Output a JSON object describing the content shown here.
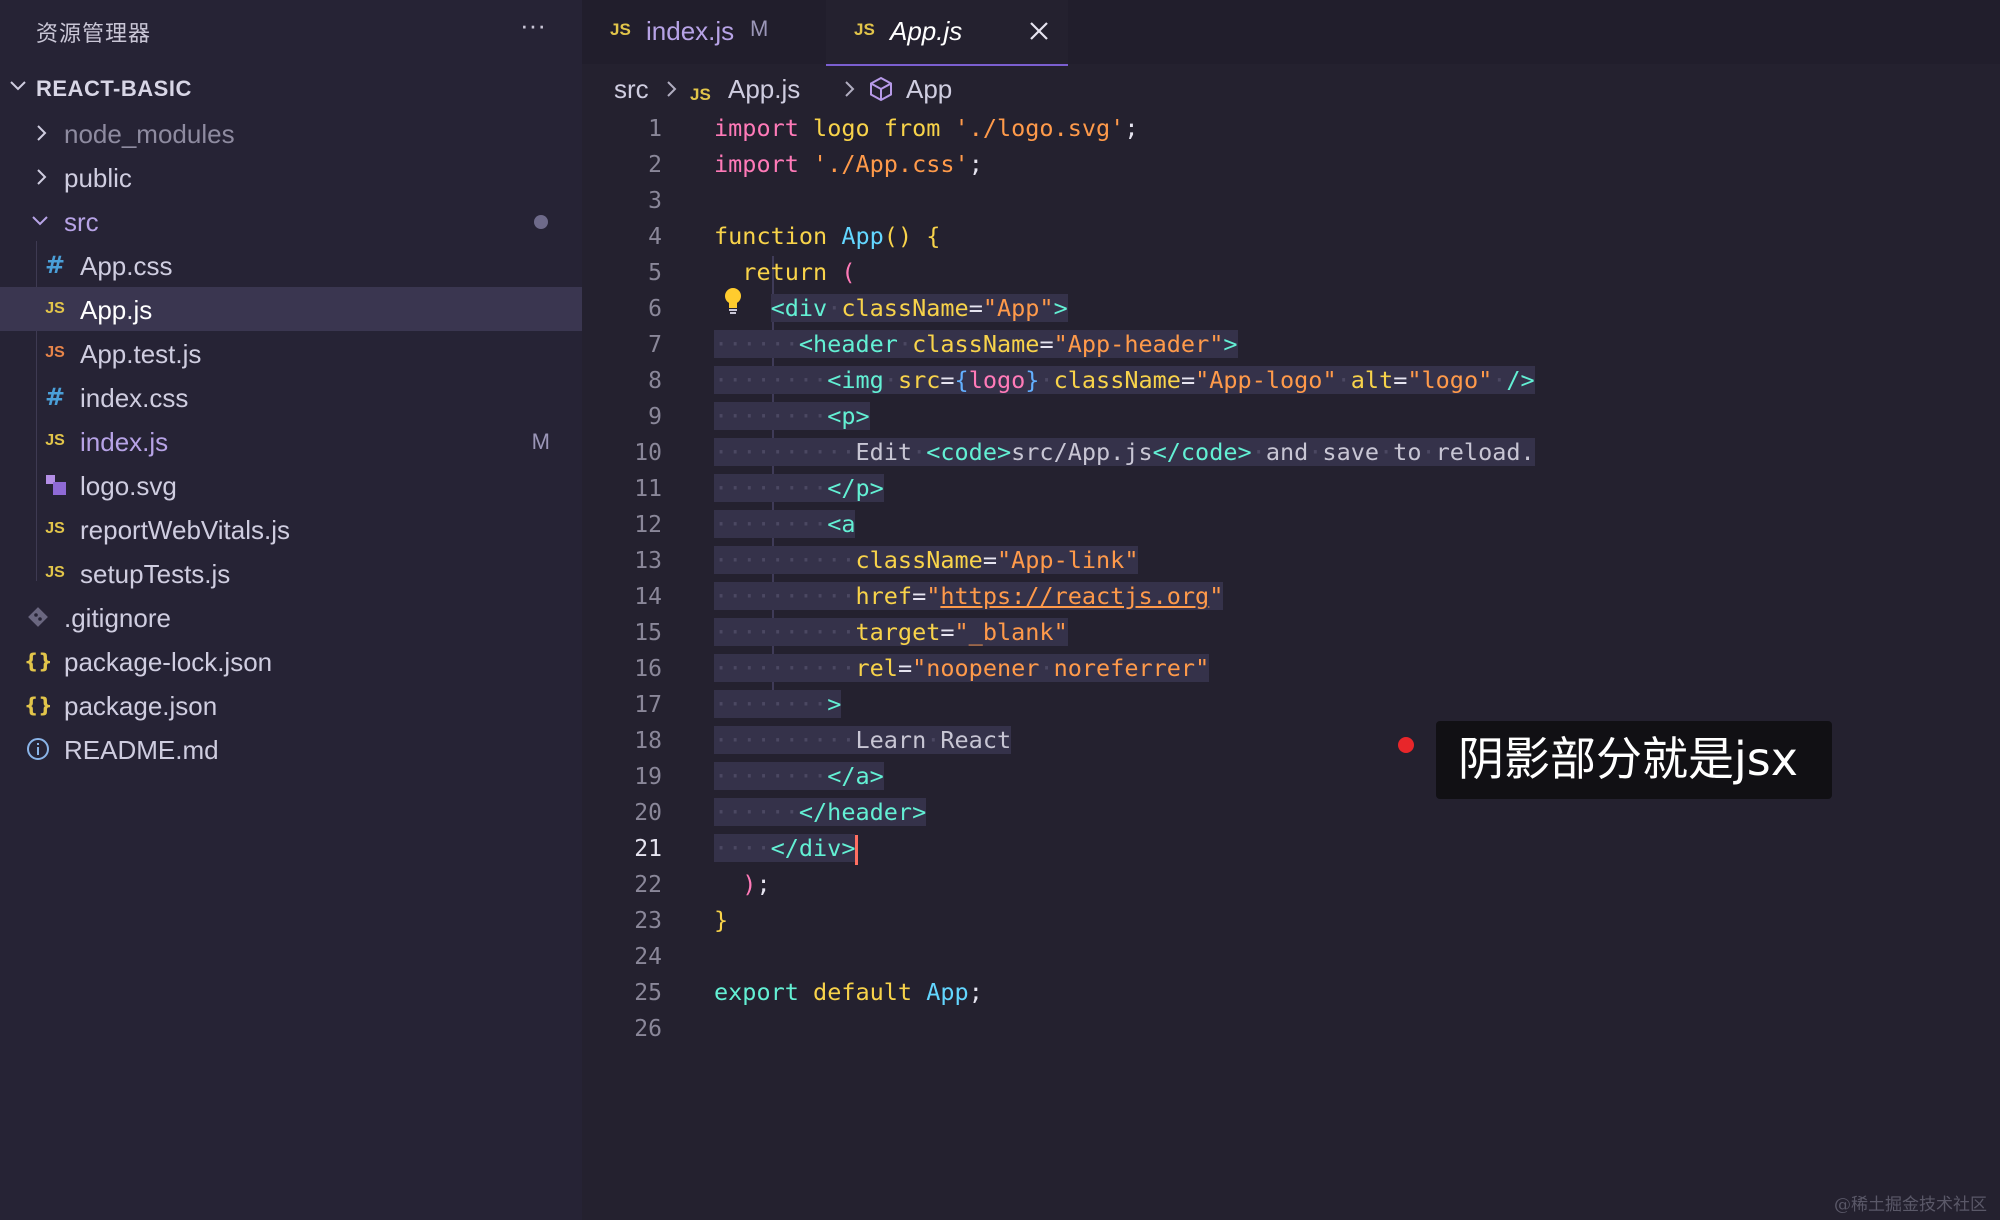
{
  "sidebar": {
    "title": "资源管理器",
    "more": "···",
    "project": "REACT-BASIC",
    "items": [
      {
        "label": "node_modules",
        "icon": "chevron-right-icon"
      },
      {
        "label": "public",
        "icon": "chevron-right-icon"
      },
      {
        "label": "src",
        "icon": "chevron-down-icon"
      },
      {
        "label": "App.css",
        "icon": "#"
      },
      {
        "label": "App.js",
        "icon": "JS"
      },
      {
        "label": "App.test.js",
        "icon": "JS"
      },
      {
        "label": "index.css",
        "icon": "#"
      },
      {
        "label": "index.js",
        "icon": "JS",
        "badge": "M"
      },
      {
        "label": "logo.svg",
        "icon": "svg-file-icon"
      },
      {
        "label": "reportWebVitals.js",
        "icon": "JS"
      },
      {
        "label": "setupTests.js",
        "icon": "JS"
      },
      {
        "label": ".gitignore",
        "icon": "git-icon"
      },
      {
        "label": "package-lock.json",
        "icon": "{}"
      },
      {
        "label": "package.json",
        "icon": "{}"
      },
      {
        "label": "README.md",
        "icon": "info-icon"
      }
    ]
  },
  "tabs": [
    {
      "icon": "JS",
      "label": "index.js",
      "badge": "M"
    },
    {
      "icon": "JS",
      "label": "App.js",
      "close": "close-icon"
    }
  ],
  "breadcrumb": [
    "src",
    "JS",
    "App.js",
    "App"
  ],
  "code": {
    "lines": [
      "import logo from './logo.svg';",
      "import './App.css';",
      "",
      "function App() {",
      "  return (",
      "    <div className=\"App\">",
      "      <header className=\"App-header\">",
      "        <img src={logo} className=\"App-logo\" alt=\"logo\" />",
      "        <p>",
      "          Edit <code>src/App.js</code> and save to reload.",
      "        </p>",
      "        <a",
      "          className=\"App-link\"",
      "          href=\"https://reactjs.org\"",
      "          target=\"_blank\"",
      "          rel=\"noopener noreferrer\"",
      "        >",
      "          Learn React",
      "        </a>",
      "      </header>",
      "    </div>",
      "  );",
      "}",
      "",
      "export default App;",
      ""
    ],
    "line_numbers": [
      "1",
      "2",
      "3",
      "4",
      "5",
      "6",
      "7",
      "8",
      "9",
      "10",
      "11",
      "12",
      "13",
      "14",
      "15",
      "16",
      "17",
      "18",
      "19",
      "20",
      "21",
      "22",
      "23",
      "24",
      "25",
      "26"
    ],
    "current_line": "21"
  },
  "annotation": "阴影部分就是jsx",
  "watermark": "@稀土掘金技术社区",
  "colors": {
    "background": "#24212f",
    "sidebar": "#262335",
    "keyword": "#f8d34a",
    "string": "#ff9a4a",
    "tag": "#63f0d4",
    "highlight": "#35324a",
    "accent": "#7b5fd0"
  }
}
